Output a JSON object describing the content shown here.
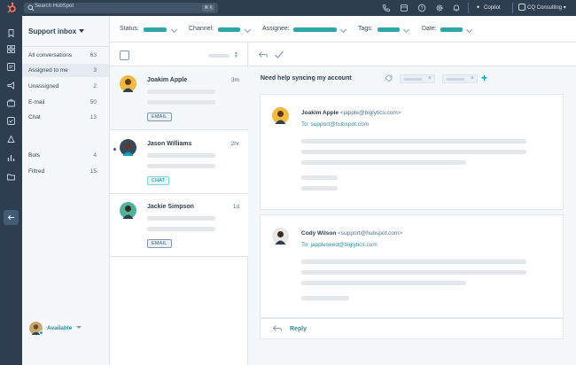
{
  "topbar": {
    "search_placeholder": "Search HubSpot",
    "search_shortcut": "⌘ K",
    "copilot_label": "Copilot",
    "account_label": "CQ Consulting"
  },
  "inbox": {
    "title": "Support inbox",
    "views": [
      {
        "label": "All conversations",
        "count": "63"
      },
      {
        "label": "Assigned to me",
        "count": "3"
      },
      {
        "label": "Unassigned",
        "count": "2"
      },
      {
        "label": "E-mail",
        "count": "50"
      },
      {
        "label": "Chat",
        "count": "13"
      }
    ],
    "channels": [
      {
        "label": "Bots",
        "count": "4"
      },
      {
        "label": "Filtred",
        "count": "15"
      }
    ],
    "status_label": "Available"
  },
  "filters": {
    "status": "Status:",
    "channel": "Channel:",
    "assignee": "Assignee:",
    "tags": "Tags:",
    "date": "Date:"
  },
  "conversations": [
    {
      "name": "Joakim Apple",
      "time": "3m",
      "tag": "EMAIL"
    },
    {
      "name": "Jason Williams",
      "time": "2hr",
      "tag": "CHAT"
    },
    {
      "name": "Jackie Simpson",
      "time": "1d",
      "tag": "EMAIL"
    }
  ],
  "thread": {
    "subject": "Need help syncing my account",
    "messages": [
      {
        "sender": "Joakim Apple",
        "sender_email": "<japple@biglytics.com>",
        "to_label": "To:",
        "to_email": "support@hubspot.com"
      },
      {
        "sender": "Cody Wilson",
        "sender_email": "<support@hubspot.com>",
        "to_label": "To:",
        "to_email": "jappleseed@biglytics.com"
      }
    ],
    "reply_label": "Reply"
  },
  "colors": {
    "nav_dark": "#2d3e50",
    "teal_accent": "#2fa6a9",
    "link_teal": "#2e8fa0"
  }
}
